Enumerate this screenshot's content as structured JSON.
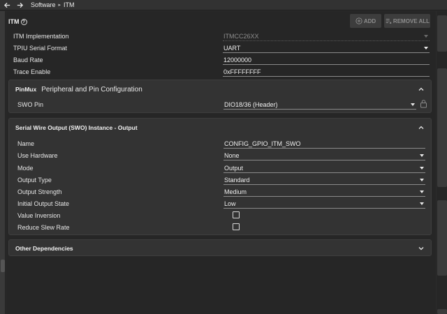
{
  "breadcrumb": {
    "items": [
      "Software",
      "ITM"
    ]
  },
  "header": {
    "title": "ITM",
    "add_label": "ADD",
    "remove_all_label": "REMOVE ALL"
  },
  "fields": [
    {
      "label": "ITM Implementation",
      "value": "ITMCC26XX"
    },
    {
      "label": "TPIU Serial Format",
      "value": "UART"
    },
    {
      "label": "Baud Rate",
      "value": "12000000"
    },
    {
      "label": "Trace Enable",
      "value": "0xFFFFFFFF"
    }
  ],
  "pinmux": {
    "title": "PinMux",
    "subtitle": "Peripheral and Pin Configuration",
    "swo_pin_label": "SWO Pin",
    "swo_pin_value": "DIO18/36 (Header)"
  },
  "swo": {
    "title": "Serial Wire Output (SWO) Instance - Output",
    "fields": [
      {
        "label": "Name",
        "value": "CONFIG_GPIO_ITM_SWO"
      },
      {
        "label": "Use Hardware",
        "value": "None"
      },
      {
        "label": "Mode",
        "value": "Output"
      },
      {
        "label": "Output Type",
        "value": "Standard"
      },
      {
        "label": "Output Strength",
        "value": "Medium"
      },
      {
        "label": "Initial Output State",
        "value": "Low"
      }
    ],
    "checkboxes": [
      {
        "label": "Value Inversion",
        "checked": false
      },
      {
        "label": "Reduce Slew Rate",
        "checked": false
      }
    ]
  },
  "other": {
    "title": "Other Dependencies"
  },
  "colors": {
    "background": "#262626",
    "panel": "#333333",
    "button_disabled": "#3d3d3d"
  }
}
